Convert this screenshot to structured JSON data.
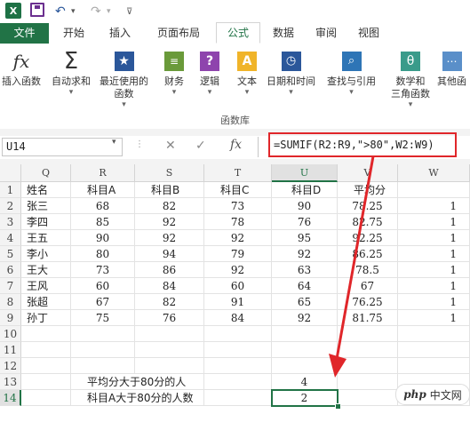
{
  "ribbon_tabs": [
    "文件",
    "开始",
    "插入",
    "页面布局",
    "公式",
    "数据",
    "审阅",
    "视图"
  ],
  "active_tab": "公式",
  "ribbon_buttons": [
    {
      "label": "插入函数",
      "icon": "fx-icon"
    },
    {
      "label": "自动求和",
      "icon": "sigma-icon",
      "caret": "▾"
    },
    {
      "label": "最近使用的\n函数",
      "icon": "star-icon",
      "caret": "▾"
    },
    {
      "label": "财务",
      "icon": "coins-icon",
      "caret": "▾"
    },
    {
      "label": "逻辑",
      "icon": "question-book-icon",
      "caret": "▾"
    },
    {
      "label": "文本",
      "icon": "text-a-icon",
      "caret": "▾"
    },
    {
      "label": "日期和时间",
      "icon": "clock-icon",
      "caret": "▾"
    },
    {
      "label": "查找与引用",
      "icon": "search-book-icon",
      "caret": "▾"
    },
    {
      "label": "数学和\n三角函数",
      "icon": "theta-icon",
      "caret": "▾"
    },
    {
      "label": "其他函",
      "icon": "more-icon",
      "caret": ""
    }
  ],
  "ribbon_group_label": "函数库",
  "name_box": "U14",
  "formula": "=SUMIF(R2:R9,\">80\",W2:W9)",
  "columns": [
    "Q",
    "R",
    "S",
    "T",
    "U",
    "V",
    "W"
  ],
  "selected_column": "U",
  "selected_row": "14",
  "rows": [
    {
      "num": "1",
      "cells": [
        "姓名",
        "科目A",
        "科目B",
        "科目C",
        "科目D",
        "平均分",
        ""
      ]
    },
    {
      "num": "2",
      "cells": [
        "张三",
        "68",
        "82",
        "73",
        "90",
        "78.25",
        "1"
      ]
    },
    {
      "num": "3",
      "cells": [
        "李四",
        "85",
        "92",
        "78",
        "76",
        "82.75",
        "1"
      ]
    },
    {
      "num": "4",
      "cells": [
        "王五",
        "90",
        "92",
        "92",
        "95",
        "92.25",
        "1"
      ]
    },
    {
      "num": "5",
      "cells": [
        "李小",
        "80",
        "94",
        "79",
        "92",
        "86.25",
        "1"
      ]
    },
    {
      "num": "6",
      "cells": [
        "王大",
        "73",
        "86",
        "92",
        "63",
        "78.5",
        "1"
      ]
    },
    {
      "num": "7",
      "cells": [
        "王风",
        "60",
        "84",
        "60",
        "64",
        "67",
        "1"
      ]
    },
    {
      "num": "8",
      "cells": [
        "张超",
        "67",
        "82",
        "91",
        "65",
        "76.25",
        "1"
      ]
    },
    {
      "num": "9",
      "cells": [
        "孙丁",
        "75",
        "76",
        "84",
        "92",
        "81.75",
        "1"
      ]
    },
    {
      "num": "10",
      "cells": [
        "",
        "",
        "",
        "",
        "",
        "",
        ""
      ]
    },
    {
      "num": "11",
      "cells": [
        "",
        "",
        "",
        "",
        "",
        "",
        ""
      ]
    },
    {
      "num": "12",
      "cells": [
        "",
        "",
        "",
        "",
        "",
        "",
        ""
      ]
    },
    {
      "num": "13",
      "cells": [
        "",
        "平均分大于80分的人",
        "",
        "",
        "4",
        "",
        ""
      ]
    },
    {
      "num": "14",
      "cells": [
        "",
        "科目A大于80分的人数",
        "",
        "",
        "2",
        "",
        ""
      ]
    }
  ],
  "watermark": {
    "logo": "php",
    "text": "中文网"
  },
  "colors": {
    "excel_green": "#217346",
    "highlight_red": "#e0262a"
  }
}
